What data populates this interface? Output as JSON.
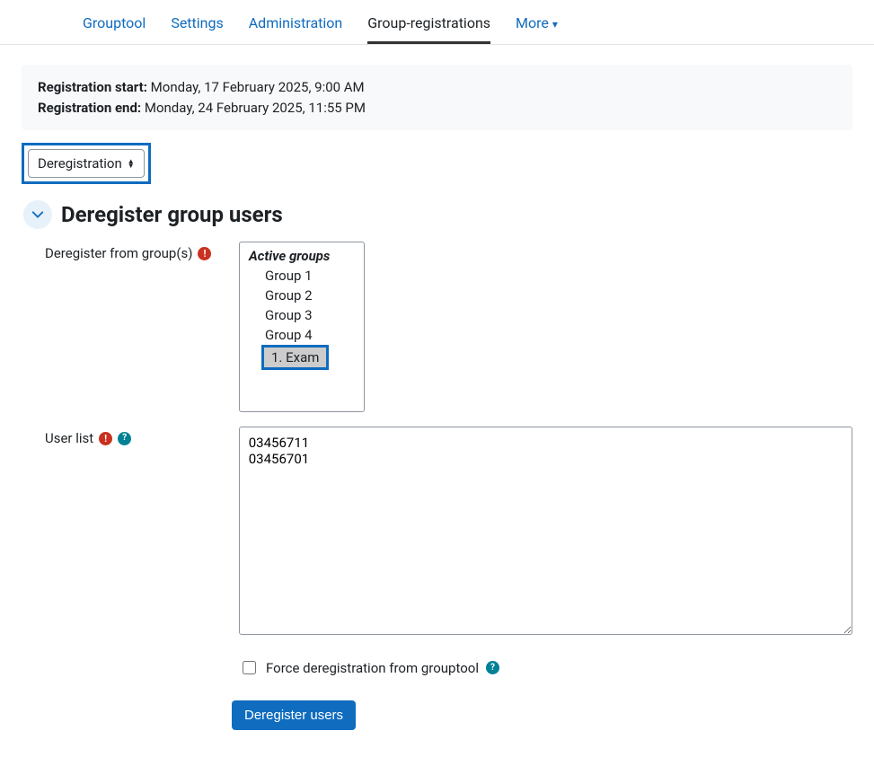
{
  "tabs": {
    "t1": "Grouptool",
    "t2": "Settings",
    "t3": "Administration",
    "t4": "Group-registrations",
    "t5": "More"
  },
  "reg": {
    "start_label": "Registration start:",
    "start_value": "Monday, 17 February 2025, 9:00 AM",
    "end_label": "Registration end:",
    "end_value": "Monday, 24 February 2025, 11:55 PM"
  },
  "mode_select": {
    "value": "Deregistration"
  },
  "section": {
    "title": "Deregister group users"
  },
  "form": {
    "groups_label": "Deregister from group(s)",
    "userlist_label": "User list",
    "group_optgroup": "Active groups",
    "groups": {
      "g1": "Group 1",
      "g2": "Group 2",
      "g3": "Group 3",
      "g4": "Group 4",
      "g5": "1. Exam"
    },
    "userlist_value": "03456711\n03456701",
    "force_label": "Force deregistration from grouptool",
    "submit_label": "Deregister users"
  }
}
